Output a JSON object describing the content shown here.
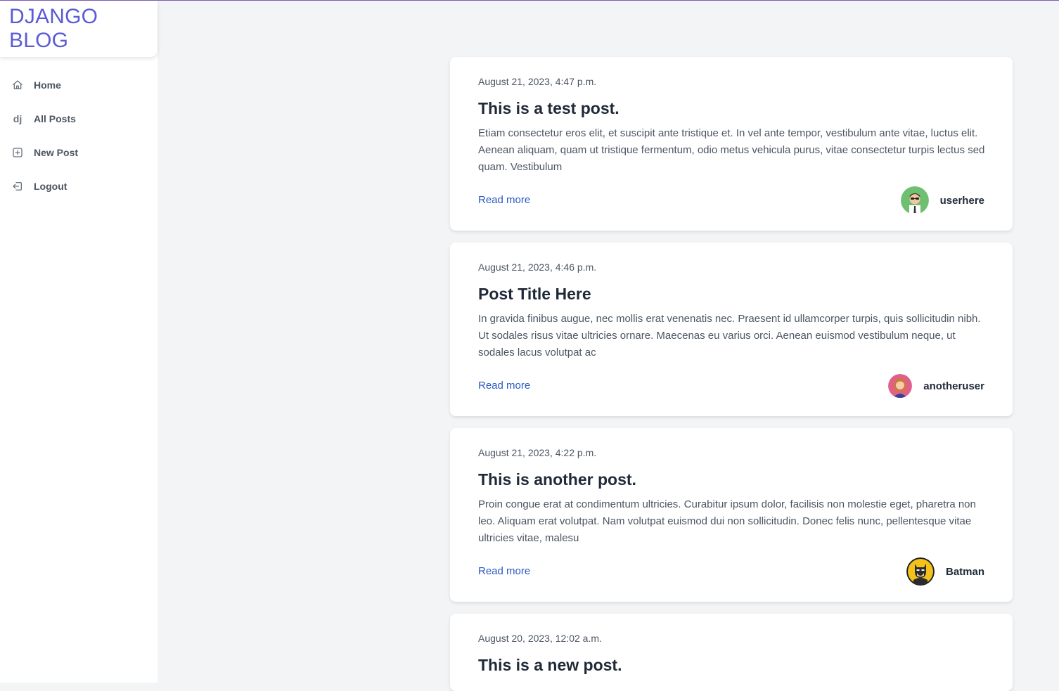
{
  "brand": {
    "title": "DJANGO BLOG"
  },
  "sidebar": {
    "items": [
      {
        "label": "Home",
        "icon": "home-icon"
      },
      {
        "label": "All Posts",
        "icon": "dj-icon",
        "glyph": "dj"
      },
      {
        "label": "New Post",
        "icon": "plus-square-icon"
      },
      {
        "label": "Logout",
        "icon": "logout-icon"
      }
    ]
  },
  "posts": [
    {
      "date": "August 21, 2023, 4:47 p.m.",
      "title": "This is a test post.",
      "excerpt": "Etiam consectetur eros elit, et suscipit ante tristique et. In vel ante tempor, vestibulum ante vitae, luctus elit. Aenean aliquam, quam ut tristique fermentum, odio metus vehicula purus, vitae consectetur turpis lectus sed quam. Vestibulum",
      "read_more": "Read more",
      "author": "userhere",
      "avatar": "man-with-sunglasses-avatar"
    },
    {
      "date": "August 21, 2023, 4:46 p.m.",
      "title": "Post Title Here",
      "excerpt": "In gravida finibus augue, nec mollis erat venenatis nec. Praesent id ullamcorper turpis, quis sollicitudin nibh. Ut sodales risus vitae ultricies ornare. Maecenas eu varius orci. Aenean euismod vestibulum neque, ut sodales lacus volutpat ac",
      "read_more": "Read more",
      "author": "anotheruser",
      "avatar": "woman-avatar"
    },
    {
      "date": "August 21, 2023, 4:22 p.m.",
      "title": "This is another post.",
      "excerpt": "Proin congue erat at condimentum ultricies. Curabitur ipsum dolor, facilisis non molestie eget, pharetra non leo. Aliquam erat volutpat. Nam volutpat euismod dui non sollicitudin. Donec felis nunc, pellentesque vitae ultricies vitae, malesu",
      "read_more": "Read more",
      "author": "Batman",
      "avatar": "batman-avatar"
    },
    {
      "date": "August 20, 2023, 12:02 a.m.",
      "title": "This is a new post."
    }
  ],
  "colors": {
    "brand": "#5b5bd6",
    "link": "#2b59c3",
    "background": "#f3f4f6",
    "card": "#ffffff"
  }
}
